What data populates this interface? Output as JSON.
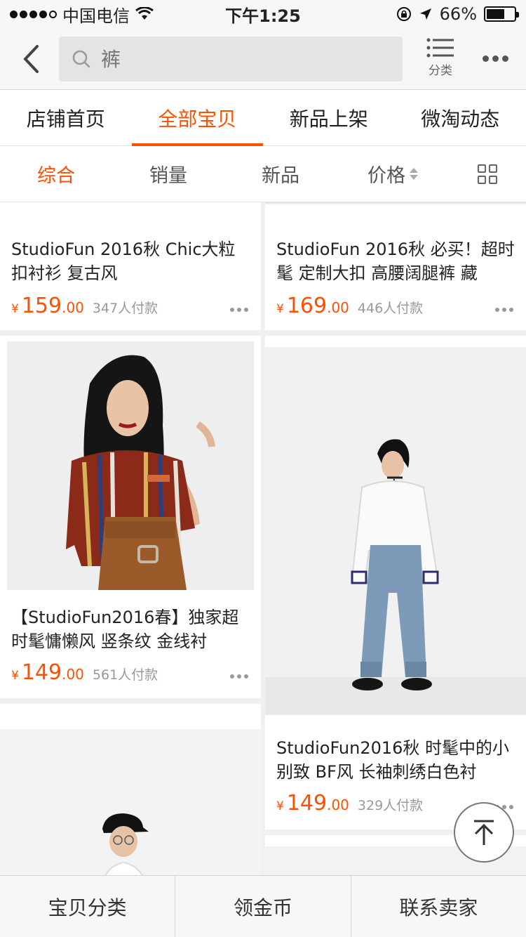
{
  "status_bar": {
    "carrier": "中国电信",
    "time": "下午1:25",
    "battery": "66%",
    "battery_level": 0.66
  },
  "navbar": {
    "search_placeholder": "裤",
    "category_label": "分类"
  },
  "shop_tabs": [
    {
      "label": "店铺首页",
      "active": false
    },
    {
      "label": "全部宝贝",
      "active": true
    },
    {
      "label": "新品上架",
      "active": false
    },
    {
      "label": "微淘动态",
      "active": false
    }
  ],
  "sort_bar": {
    "items": [
      "综合",
      "销量",
      "新品",
      "价格"
    ],
    "active": "综合"
  },
  "products": [
    {
      "title": "StudioFun 2016秋 Chic大粒扣衬衫 复古风",
      "yen": "¥",
      "price_int": "159",
      "price_dec": ".00",
      "sold": "347人付款"
    },
    {
      "title": "StudioFun 2016秋 必买！超时髦 定制大扣 高腰阔腿裤 藏",
      "yen": "¥",
      "price_int": "169",
      "price_dec": ".00",
      "sold": "446人付款"
    },
    {
      "title": "【StudioFun2016春】独家超时髦慵懒风 竖条纹 金线衬",
      "yen": "¥",
      "price_int": "149",
      "price_dec": ".00",
      "sold": "561人付款"
    },
    {
      "title": "StudioFun2016秋 时髦中的小别致 BF风 长袖刺绣白色衬",
      "yen": "¥",
      "price_int": "149",
      "price_dec": ".00",
      "sold": "329人付款"
    }
  ],
  "bottom_bar": [
    "宝贝分类",
    "领金币",
    "联系卖家"
  ],
  "colors": {
    "accent": "#ff5000"
  }
}
